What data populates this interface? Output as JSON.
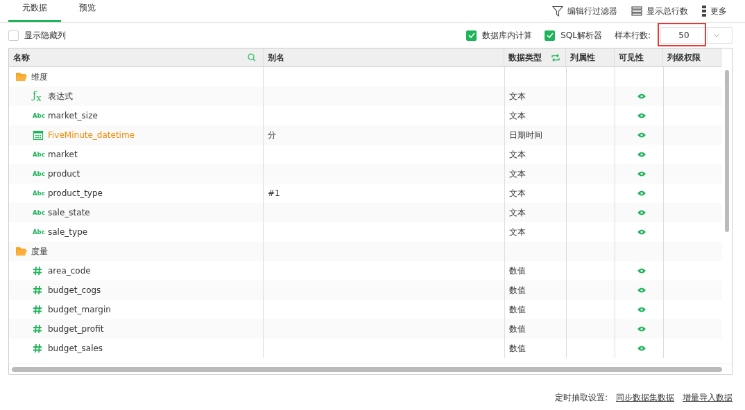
{
  "tabs": [
    {
      "label": "元数据",
      "selected": true
    },
    {
      "label": "预览",
      "selected": false
    }
  ],
  "toolbar": [
    {
      "kind": "filter",
      "label": "编辑行过滤器"
    },
    {
      "kind": "rows",
      "label": "显示总行数"
    },
    {
      "kind": "more",
      "label": "更多"
    }
  ],
  "options": {
    "show_hidden": {
      "label": "显示隐藏列",
      "checked": false
    },
    "db_compute": {
      "label": "数据库内计算",
      "checked": true
    },
    "sql_parser": {
      "label": "SQL解析器",
      "checked": true
    },
    "sample_rows": {
      "label": "样本行数:",
      "value": "50",
      "highlighted": true
    }
  },
  "table": {
    "columns": [
      "名称",
      "别名",
      "数据类型",
      "列属性",
      "可见性",
      "列级权限"
    ],
    "groups": [
      {
        "name": "维度",
        "children": [
          {
            "kind": "expression",
            "icon_text": "ƒ$_{x}$",
            "name": "表达式",
            "highlighted": false,
            "data_type": "文本",
            "visible": true
          },
          {
            "kind": "text",
            "icon_text": "Abc",
            "name": "market_size",
            "highlighted": false,
            "data_type": "文本",
            "visible": true
          },
          {
            "kind": "datetime",
            "name": "FiveMinute_datetime",
            "highlighted": true,
            "alias": "分",
            "data_type": "日期时间",
            "visible": true
          },
          {
            "kind": "text",
            "icon_text": "Abc",
            "name": "market",
            "highlighted": false,
            "data_type": "文本",
            "visible": true
          },
          {
            "kind": "text",
            "icon_text": "Abc",
            "name": "product",
            "highlighted": false,
            "data_type": "文本",
            "visible": true
          },
          {
            "kind": "text",
            "icon_text": "Abc",
            "name": "product_type",
            "highlighted": false,
            "alias": "#1",
            "data_type": "文本",
            "visible": true
          },
          {
            "kind": "text",
            "icon_text": "Abc",
            "name": "sale_state",
            "highlighted": false,
            "data_type": "文本",
            "visible": true
          },
          {
            "kind": "text",
            "icon_text": "Abc",
            "name": "sale_type",
            "highlighted": false,
            "data_type": "文本",
            "visible": true
          }
        ]
      },
      {
        "name": "度量",
        "children": [
          {
            "kind": "number",
            "name": "area_code",
            "highlighted": false,
            "data_type": "数值",
            "visible": true
          },
          {
            "kind": "number",
            "name": "budget_cogs",
            "highlighted": false,
            "data_type": "数值",
            "visible": true
          },
          {
            "kind": "number",
            "name": "budget_margin",
            "highlighted": false,
            "data_type": "数值",
            "visible": true
          },
          {
            "kind": "number",
            "name": "budget_profit",
            "highlighted": false,
            "data_type": "数值",
            "visible": true
          },
          {
            "kind": "number",
            "name": "budget_sales",
            "highlighted": false,
            "data_type": "数值",
            "visible": true
          }
        ]
      }
    ]
  },
  "footer": {
    "label": "定时抽取设置:",
    "links": [
      "同步数据集数据",
      "增量导入数据"
    ]
  }
}
